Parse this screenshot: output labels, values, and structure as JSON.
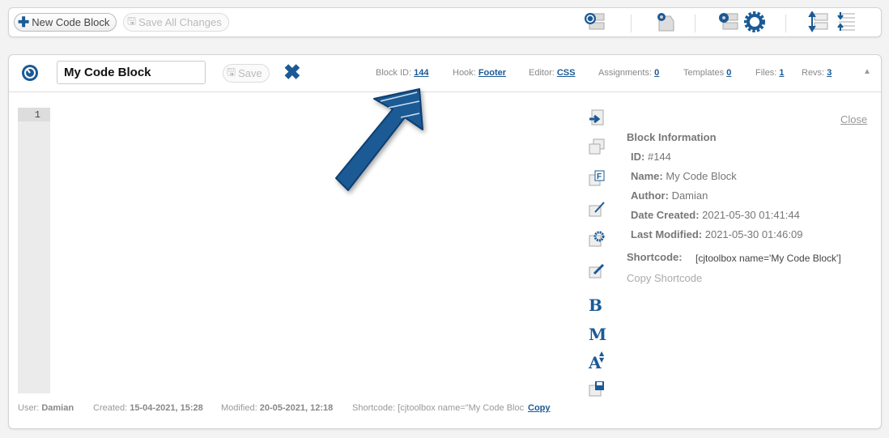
{
  "toolbar": {
    "new_label": "New Code Block",
    "save_all_label": "Save All Changes"
  },
  "block": {
    "name": "My Code Block",
    "save_label": "Save",
    "meta": {
      "block_id_label": "Block ID:",
      "block_id": "144",
      "hook_label": "Hook:",
      "hook": "Footer",
      "editor_label": "Editor:",
      "editor": "CSS",
      "assignments_label": "Assignments:",
      "assignments": "0",
      "templates_label": "Templates",
      "templates": "0",
      "files_label": "Files:",
      "files": "1",
      "revs_label": "Revs:",
      "revs": "3"
    }
  },
  "editor": {
    "line_numbers": [
      "1"
    ]
  },
  "info": {
    "close": "Close",
    "title": "Block Information",
    "id_label": "ID:",
    "id": "#144",
    "name_label": "Name:",
    "name": "My Code Block",
    "author_label": "Author:",
    "author": "Damian",
    "created_label": "Date Created:",
    "created": "2021-05-30 01:41:44",
    "modified_label": "Last Modified:",
    "modified": "2021-05-30 01:46:09",
    "shortcode_label": "Shortcode:",
    "shortcode": "[cjtoolbox name='My Code Block']",
    "copy_shortcode": "Copy Shortcode"
  },
  "side_letters": {
    "bold": "B",
    "m": "M",
    "font": "A"
  },
  "footer": {
    "user_label": "User:",
    "user": "Damian",
    "created_label": "Created:",
    "created": "15-04-2021, 15:28",
    "modified_label": "Modified:",
    "modified": "20-05-2021, 12:18",
    "shortcode_label": "Shortcode:",
    "shortcode": "[cjtoolbox name=\"My Code Bloc",
    "copy": "Copy"
  },
  "colors": {
    "accent": "#1b5a95",
    "background": "#f3f3f3"
  }
}
